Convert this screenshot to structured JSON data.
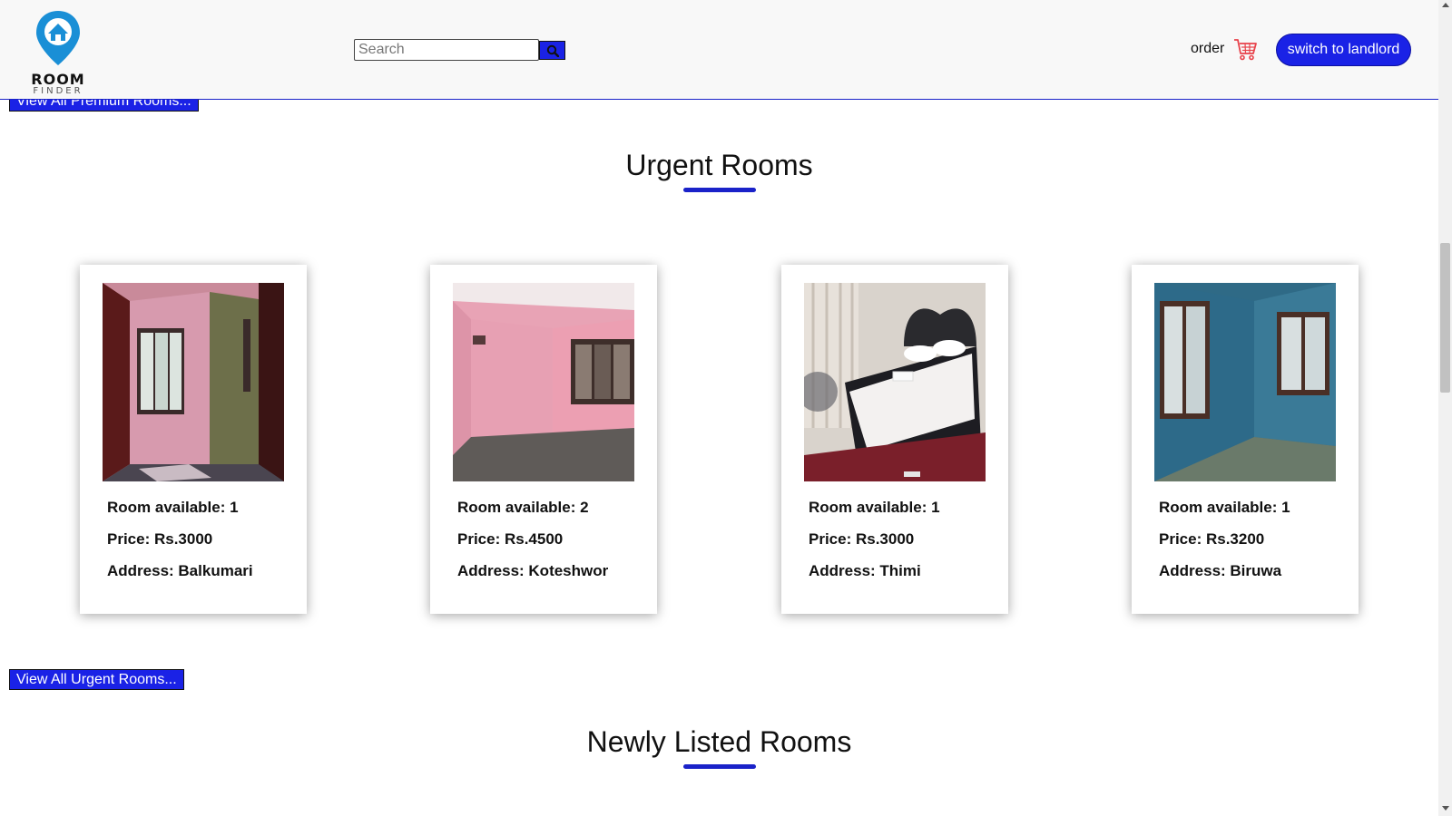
{
  "navbar": {
    "logo": {
      "word_top": "ROOM",
      "word_bottom": "FINDER",
      "pin_color": "#1a8fd6"
    },
    "search": {
      "placeholder": "Search",
      "value": "",
      "button_icon": "search-icon"
    },
    "order_label": "order",
    "cart_icon": "cart-icon",
    "switch_button_label": "switch to landlord"
  },
  "colors": {
    "accent": "#1a22e6",
    "underline": "#1a22c9",
    "cart": "#e8424a"
  },
  "premium_section": {
    "view_all_label": "View All Premium Rooms..."
  },
  "urgent_section": {
    "title": "Urgent Rooms",
    "view_all_label": "View All Urgent Rooms...",
    "rooms": [
      {
        "photo": "pink-room-photo",
        "available": "Room available: 1",
        "price": "Price: Rs.3000",
        "address": "Address: Balkumari"
      },
      {
        "photo": "pink-empty-room-photo",
        "available": "Room available: 2",
        "price": "Price: Rs.4500",
        "address": "Address: Koteshwor"
      },
      {
        "photo": "bedroom-photo",
        "available": "Room available: 1",
        "price": "Price: Rs.3000",
        "address": "Address: Thimi"
      },
      {
        "photo": "blue-room-photo",
        "available": "Room available: 1",
        "price": "Price: Rs.3200",
        "address": "Address: Biruwa"
      }
    ]
  },
  "new_section": {
    "title": "Newly Listed Rooms"
  }
}
